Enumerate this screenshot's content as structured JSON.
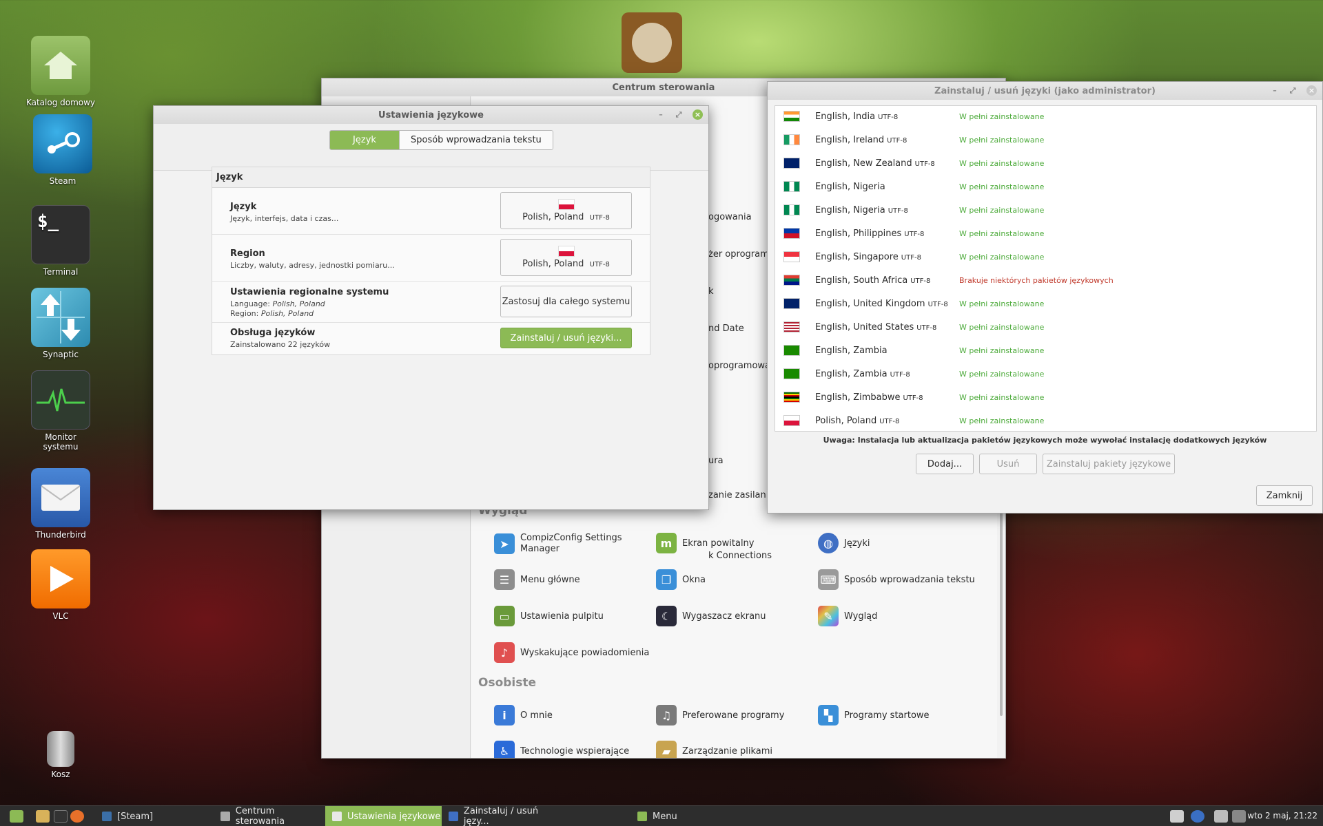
{
  "desktop": {
    "icons": [
      {
        "label": "Katalog domowy"
      },
      {
        "label": "Steam"
      },
      {
        "label": "Terminal",
        "glyph": "$_"
      },
      {
        "label": "Synaptic"
      },
      {
        "label": "Monitor systemu"
      },
      {
        "label": "Thunderbird"
      },
      {
        "label": "VLC"
      },
      {
        "label": "Kosz"
      }
    ]
  },
  "control_center": {
    "title": "Centrum sterowania",
    "peek": [
      "ogowania",
      "żer oprogramow",
      "k",
      "nd Date",
      "oprogramowar",
      "ura",
      "zanie zasilanier",
      "k Connections"
    ],
    "sections": {
      "appearance": "Wygląd",
      "personal": "Osobiste"
    },
    "appearance_items": [
      {
        "label": "CompizConfig Settings Manager",
        "icon": "cursor-icon",
        "color": "#3a8fd8"
      },
      {
        "label": "Ekran powitalny",
        "icon": "mint-icon",
        "color": "#7cb342"
      },
      {
        "label": "Języki",
        "icon": "globe-icon",
        "color": "#3f6fc4"
      },
      {
        "label": "Menu główne",
        "icon": "menu-editor-icon",
        "color": "#8d8d8d"
      },
      {
        "label": "Okna",
        "icon": "windows-icon",
        "color": "#3a8fd8"
      },
      {
        "label": "Sposób wprowadzania tekstu",
        "icon": "keyboard-icon",
        "color": "#9a9a9a"
      },
      {
        "label": "Ustawienia pulpitu",
        "icon": "desktop-icon",
        "color": "#6a9a3a"
      },
      {
        "label": "Wygaszacz ekranu",
        "icon": "moon-icon",
        "color": "#2a2a3a"
      },
      {
        "label": "Wygląd",
        "icon": "brush-icon",
        "color": "#b04ad8"
      },
      {
        "label": "Wyskakujące powiadomienia",
        "icon": "bell-icon",
        "color": "#e05050"
      }
    ],
    "personal_items": [
      {
        "label": "O mnie",
        "icon": "info-icon",
        "color": "#3a7ad8"
      },
      {
        "label": "Preferowane programy",
        "icon": "music-icon",
        "color": "#7a7a7a"
      },
      {
        "label": "Programy startowe",
        "icon": "startup-icon",
        "color": "#3a8fd8"
      },
      {
        "label": "Technologie wspierające",
        "icon": "accessibility-icon",
        "color": "#2a6ad8"
      },
      {
        "label": "Zarządzanie plikami",
        "icon": "folder-icon",
        "color": "#c8a450"
      }
    ]
  },
  "language_settings": {
    "title": "Ustawienia językowe",
    "tabs": [
      "Język",
      "Sposób wprowadzania tekstu"
    ],
    "panel_title": "Język",
    "rows": {
      "language": {
        "title": "Język",
        "subtitle": "Język, interfejs, data i czas...",
        "value": "Polish, Poland",
        "encoding": "UTF-8"
      },
      "region": {
        "title": "Region",
        "subtitle": "Liczby, waluty, adresy, jednostki pomiaru...",
        "value": "Polish, Poland",
        "encoding": "UTF-8"
      },
      "system": {
        "title": "Ustawienia regionalne systemu",
        "lang_prefix": "Language:",
        "lang_value": "Polish, Poland",
        "region_prefix": "Region:",
        "region_value": "Polish, Poland",
        "button": "Zastosuj dla całego systemu"
      },
      "support": {
        "title": "Obsługa języków",
        "subtitle": "Zainstalowano 22 języków",
        "button": "Zainstaluj / usuń języki..."
      }
    }
  },
  "install_languages": {
    "title": "Zainstaluj / usuń języki (jako administrator)",
    "languages": [
      {
        "name": "English, India",
        "enc": "UTF-8",
        "status": "W pełni zainstalowane",
        "flag": "f-in",
        "ok": true
      },
      {
        "name": "English, Ireland",
        "enc": "UTF-8",
        "status": "W pełni zainstalowane",
        "flag": "f-ie",
        "ok": true
      },
      {
        "name": "English, New Zealand",
        "enc": "UTF-8",
        "status": "W pełni zainstalowane",
        "flag": "f-nz",
        "ok": true
      },
      {
        "name": "English, Nigeria",
        "enc": "",
        "status": "W pełni zainstalowane",
        "flag": "f-ng",
        "ok": true
      },
      {
        "name": "English, Nigeria",
        "enc": "UTF-8",
        "status": "W pełni zainstalowane",
        "flag": "f-ng",
        "ok": true
      },
      {
        "name": "English, Philippines",
        "enc": "UTF-8",
        "status": "W pełni zainstalowane",
        "flag": "f-ph",
        "ok": true
      },
      {
        "name": "English, Singapore",
        "enc": "UTF-8",
        "status": "W pełni zainstalowane",
        "flag": "f-sg",
        "ok": true
      },
      {
        "name": "English, South Africa",
        "enc": "UTF-8",
        "status": "Brakuje niektórych pakietów językowych",
        "flag": "f-za",
        "ok": false
      },
      {
        "name": "English, United Kingdom",
        "enc": "UTF-8",
        "status": "W pełni zainstalowane",
        "flag": "f-gb",
        "ok": true
      },
      {
        "name": "English, United States",
        "enc": "UTF-8",
        "status": "W pełni zainstalowane",
        "flag": "f-us",
        "ok": true
      },
      {
        "name": "English, Zambia",
        "enc": "",
        "status": "W pełni zainstalowane",
        "flag": "f-zm",
        "ok": true
      },
      {
        "name": "English, Zambia",
        "enc": "UTF-8",
        "status": "W pełni zainstalowane",
        "flag": "f-zm",
        "ok": true
      },
      {
        "name": "English, Zimbabwe",
        "enc": "UTF-8",
        "status": "W pełni zainstalowane",
        "flag": "f-zw",
        "ok": true
      },
      {
        "name": "Polish, Poland",
        "enc": "UTF-8",
        "status": "W pełni zainstalowane",
        "flag": "f-pl",
        "ok": true
      }
    ],
    "note": "Uwaga: Instalacja lub aktualizacja pakietów językowych może wywołać instalację dodatkowych języków",
    "buttons": {
      "add": "Dodaj...",
      "remove": "Usuń",
      "install": "Zainstaluj pakiety językowe",
      "close": "Zamknij"
    }
  },
  "taskbar": {
    "tasks": [
      {
        "label": "[Steam]",
        "active": false
      },
      {
        "label": "Centrum sterowania",
        "active": false
      },
      {
        "label": "Ustawienia językowe",
        "active": true
      },
      {
        "label": "Zainstaluj / usuń języ...",
        "active": false
      }
    ],
    "menu": "Menu",
    "clock": "wto  2 maj, 21:22"
  },
  "colors": {
    "accent": "#8cba55",
    "ok": "#4caa3a",
    "warn": "#c0392b"
  }
}
